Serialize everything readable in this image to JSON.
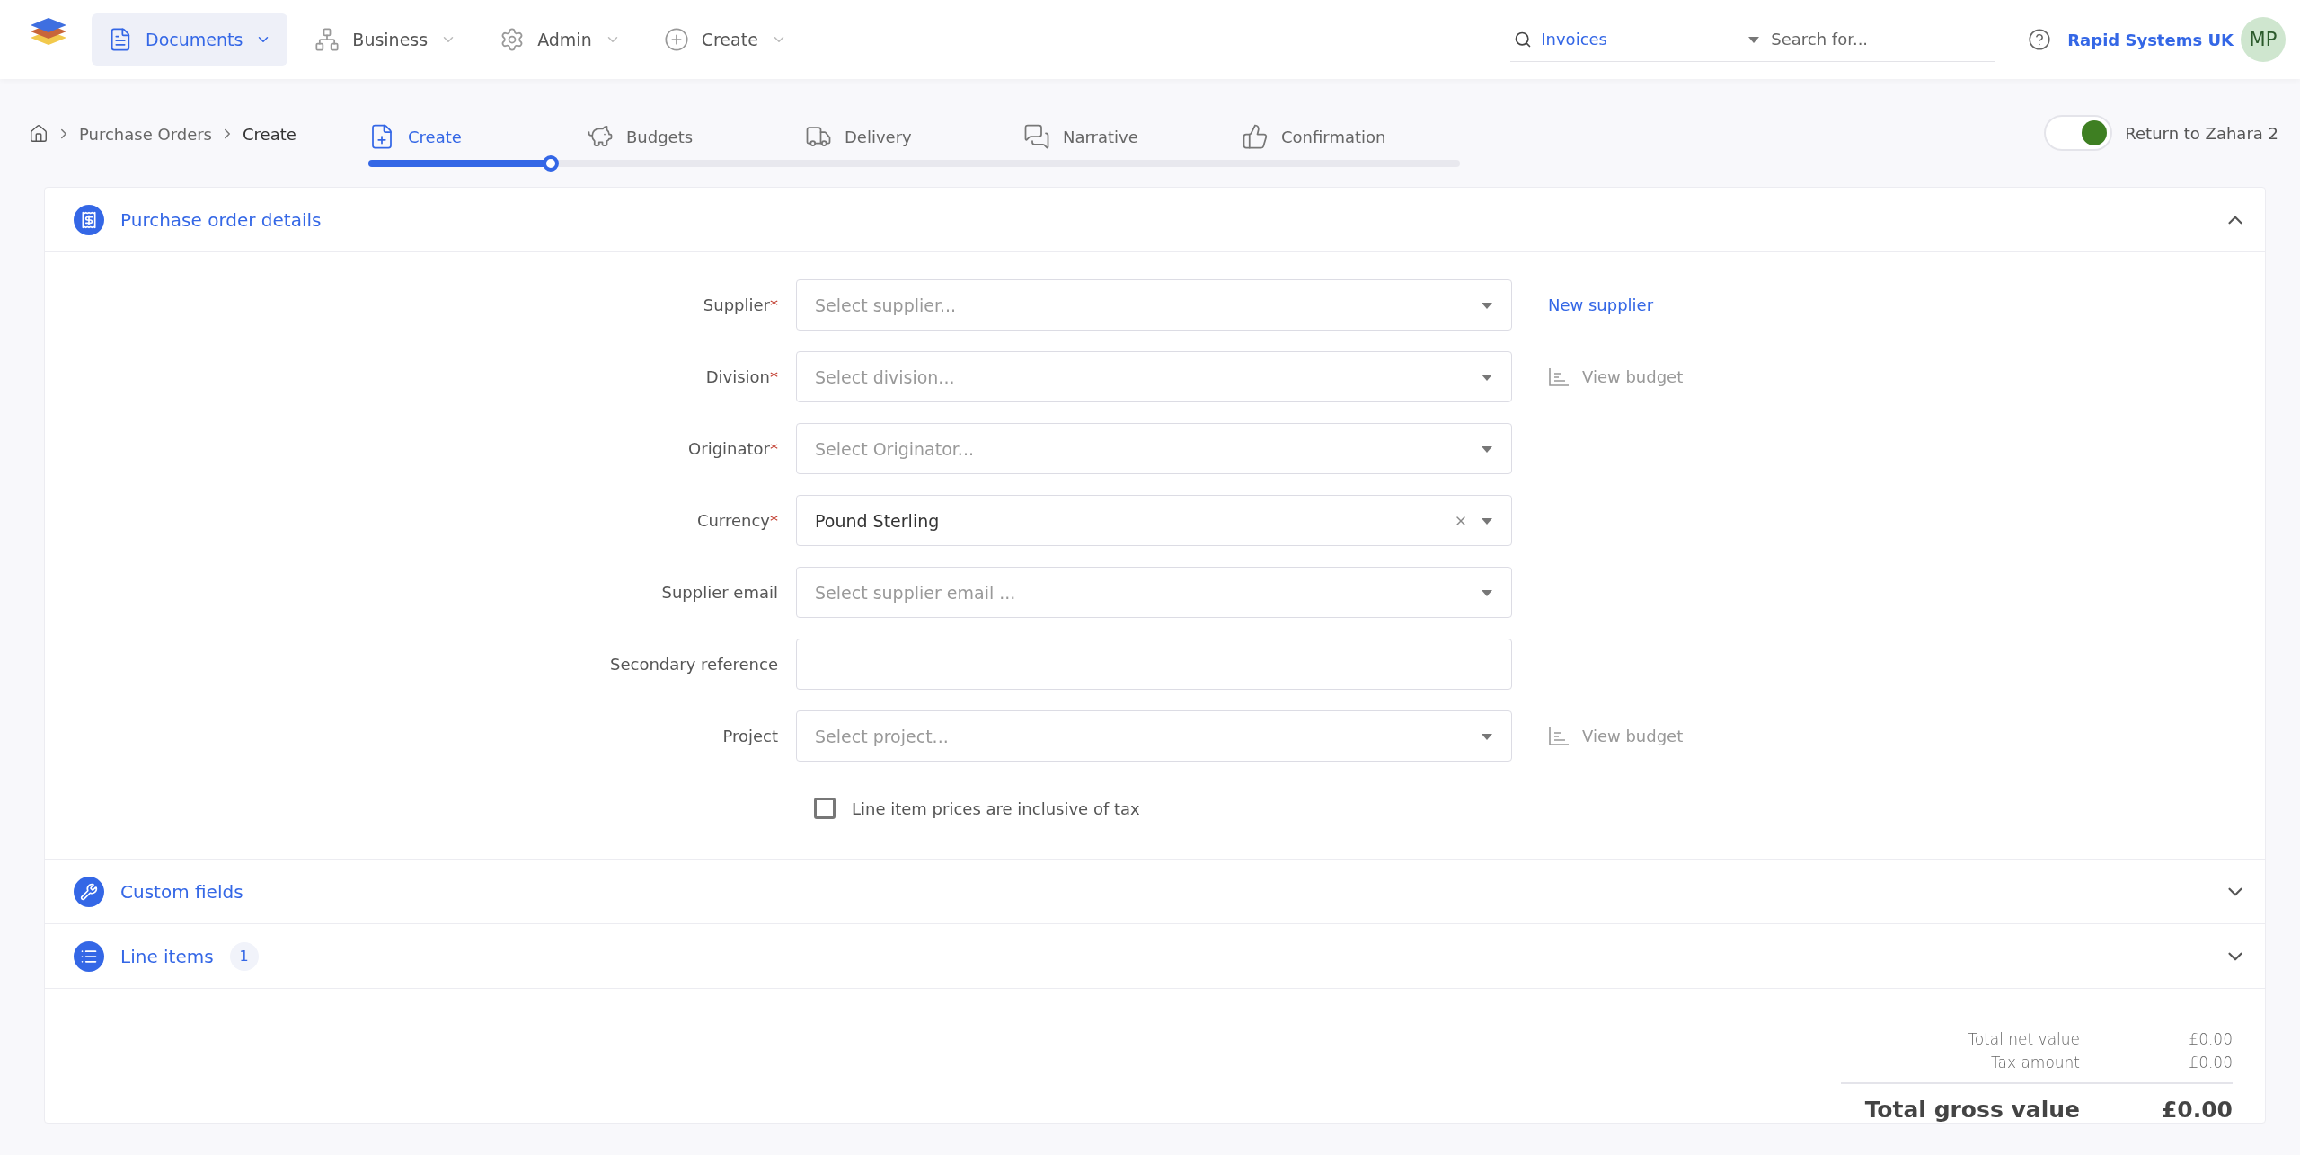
{
  "nav": {
    "items": [
      {
        "kind": "documents",
        "label": "Documents",
        "selected": true
      },
      {
        "kind": "business",
        "label": "Business",
        "selected": false
      },
      {
        "kind": "admin",
        "label": "Admin",
        "selected": false
      },
      {
        "kind": "create",
        "label": "Create",
        "selected": false
      }
    ]
  },
  "search": {
    "scope": "Invoices",
    "placeholder": "Search for..."
  },
  "user": {
    "company": "Rapid Systems UK",
    "initials": "MP"
  },
  "breadcrumb": [
    "Purchase Orders",
    "Create"
  ],
  "steps": {
    "level": 0.167,
    "items": [
      {
        "kind": "create",
        "label": "Create",
        "selected": true
      },
      {
        "kind": "budgets",
        "label": "Budgets",
        "selected": false
      },
      {
        "kind": "delivery",
        "label": "Delivery",
        "selected": false
      },
      {
        "kind": "narrative",
        "label": "Narrative",
        "selected": false
      },
      {
        "kind": "confirmation",
        "label": "Confirmation",
        "selected": false
      }
    ]
  },
  "toggle": {
    "label": "Return to Zahara 2",
    "on": true
  },
  "details": {
    "title": "Purchase order details",
    "expanded": true,
    "fields": [
      {
        "label": "Supplier",
        "mark": "*",
        "kind": "select",
        "placeholder": "Select supplier...",
        "action": {
          "kind": "link",
          "label": "New supplier"
        }
      },
      {
        "label": "Division",
        "mark": "*",
        "kind": "select",
        "placeholder": "Select division...",
        "action": {
          "kind": "budget",
          "label": "View budget"
        }
      },
      {
        "label": "Originator",
        "mark": "*",
        "kind": "select",
        "placeholder": "Select Originator..."
      },
      {
        "label": "Currency",
        "mark": "*",
        "kind": "select",
        "value": "Pound Sterling",
        "clearable": true
      },
      {
        "label": "Supplier email",
        "kind": "select",
        "placeholder": "Select supplier email ..."
      },
      {
        "label": "Secondary reference",
        "kind": "text"
      },
      {
        "label": "Project",
        "kind": "select",
        "placeholder": "Select project...",
        "action": {
          "kind": "budget",
          "label": "View budget"
        }
      }
    ],
    "checkbox": {
      "label": "Line item prices are inclusive of tax",
      "checked": false
    }
  },
  "sections": [
    {
      "kind": "custom",
      "title": "Custom fields",
      "expanded": false
    },
    {
      "kind": "lines",
      "title": "Line items",
      "count": "1",
      "expanded": false
    }
  ],
  "totals": [
    {
      "kind": "minor",
      "label": "Total net value",
      "value": "£0.00"
    },
    {
      "kind": "minor",
      "label": "Tax amount",
      "value": "£0.00"
    },
    {
      "kind": "major",
      "label": "Total gross value",
      "value": "£0.00"
    }
  ]
}
